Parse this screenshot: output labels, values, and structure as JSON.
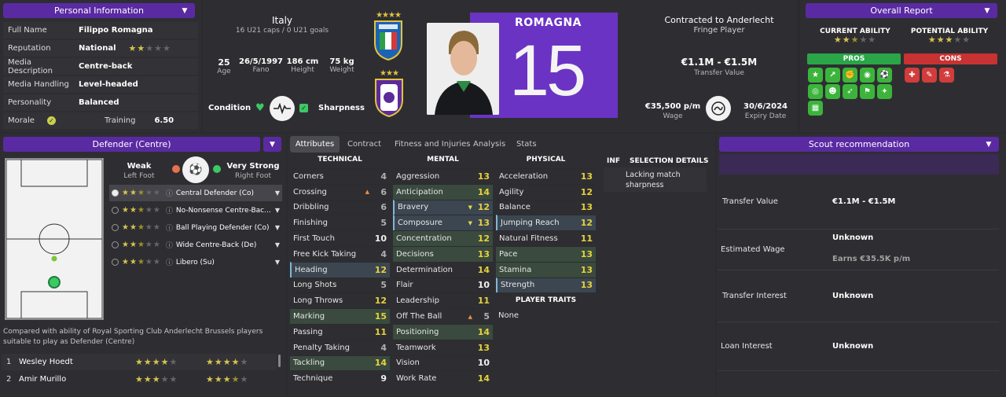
{
  "personal": {
    "header": "Personal Information",
    "rows": [
      {
        "label": "Full Name",
        "value": "Filippo Romagna"
      },
      {
        "label": "Reputation",
        "value": "National"
      },
      {
        "label": "Media Description",
        "value": "Centre-back"
      },
      {
        "label": "Media Handling",
        "value": "Level-headed"
      },
      {
        "label": "Personality",
        "value": "Balanced"
      }
    ],
    "morale_label": "Morale",
    "training_label": "Training",
    "training_value": "6.50"
  },
  "nation": {
    "country": "Italy",
    "caps": "16 U21 caps / 0 U21 goals"
  },
  "bio": [
    {
      "value": "25",
      "label": "Age"
    },
    {
      "value": "26/5/1997",
      "label": "Fano"
    },
    {
      "value": "186 cm",
      "label": "Height"
    },
    {
      "value": "75 kg",
      "label": "Weight"
    }
  ],
  "condition_label": "Condition",
  "sharpness_label": "Sharpness",
  "player": {
    "surname": "ROMAGNA",
    "number": "15"
  },
  "contract": {
    "club": "Contracted to Anderlecht",
    "status": "Fringe Player",
    "value": "€1.1M - €1.5M",
    "value_label": "Transfer Value",
    "wage": "€35,500 p/m",
    "wage_label": "Wage",
    "expiry": "30/6/2024",
    "expiry_label": "Expiry Date"
  },
  "report": {
    "header": "Overall Report",
    "ca_label": "CURRENT ABILITY",
    "pa_label": "POTENTIAL ABILITY",
    "pros": "PROS",
    "cons": "CONS"
  },
  "position": {
    "header": "Defender (Centre)",
    "weak_label": "Weak",
    "weak_sub": "Left Foot",
    "strong_label": "Very Strong",
    "strong_sub": "Right Foot",
    "roles": [
      "Central Defender (Co)",
      "No-Nonsense Centre-Bac...",
      "Ball Playing Defender (Co)",
      "Wide Centre-Back (De)",
      "Libero (Su)"
    ],
    "compare_text": "Compared with ability of Royal Sporting Club Anderlecht Brussels players suitable to play as Defender (Centre)",
    "players": [
      {
        "rank": "1",
        "name": "Wesley Hoedt"
      },
      {
        "rank": "2",
        "name": "Amir Murillo"
      }
    ]
  },
  "tabs": [
    "Attributes",
    "Contract",
    "Fitness and Injuries",
    "Analysis",
    "Stats"
  ],
  "attributes": {
    "technical_title": "TECHNICAL",
    "mental_title": "MENTAL",
    "physical_title": "PHYSICAL",
    "technical": [
      [
        "Corners",
        "4"
      ],
      [
        "Crossing",
        "6"
      ],
      [
        "Dribbling",
        "6"
      ],
      [
        "Finishing",
        "5"
      ],
      [
        "First Touch",
        "10"
      ],
      [
        "Free Kick Taking",
        "4"
      ],
      [
        "Heading",
        "12"
      ],
      [
        "Long Shots",
        "5"
      ],
      [
        "Long Throws",
        "12"
      ],
      [
        "Marking",
        "15"
      ],
      [
        "Passing",
        "11"
      ],
      [
        "Penalty Taking",
        "4"
      ],
      [
        "Tackling",
        "14"
      ],
      [
        "Technique",
        "9"
      ]
    ],
    "mental": [
      [
        "Aggression",
        "13"
      ],
      [
        "Anticipation",
        "14"
      ],
      [
        "Bravery",
        "12"
      ],
      [
        "Composure",
        "13"
      ],
      [
        "Concentration",
        "12"
      ],
      [
        "Decisions",
        "13"
      ],
      [
        "Determination",
        "14"
      ],
      [
        "Flair",
        "10"
      ],
      [
        "Leadership",
        "11"
      ],
      [
        "Off The Ball",
        "5"
      ],
      [
        "Positioning",
        "14"
      ],
      [
        "Teamwork",
        "13"
      ],
      [
        "Vision",
        "10"
      ],
      [
        "Work Rate",
        "14"
      ]
    ],
    "physical": [
      [
        "Acceleration",
        "13"
      ],
      [
        "Agility",
        "12"
      ],
      [
        "Balance",
        "13"
      ],
      [
        "Jumping Reach",
        "12"
      ],
      [
        "Natural Fitness",
        "11"
      ],
      [
        "Pace",
        "13"
      ],
      [
        "Stamina",
        "13"
      ],
      [
        "Strength",
        "13"
      ]
    ],
    "traits_title": "PLAYER TRAITS",
    "traits_value": "None"
  },
  "inf": {
    "title": "INF",
    "sel_title": "SELECTION DETAILS",
    "sel_text": "Lacking match sharpness"
  },
  "scout": {
    "header": "Scout recommendation",
    "rows": [
      {
        "label": "Transfer Value",
        "value": "€1.1M - €1.5M"
      },
      {
        "label": "Estimated Wage",
        "value": "Unknown",
        "sub": "Earns €35.5K p/m"
      },
      {
        "label": "Transfer Interest",
        "value": "Unknown"
      },
      {
        "label": "Loan Interest",
        "value": "Unknown"
      }
    ]
  },
  "colors": {
    "purple": "#5a2aa3",
    "green": "#3cb43c",
    "red": "#d23c3c",
    "gold": "#d7c44e"
  }
}
